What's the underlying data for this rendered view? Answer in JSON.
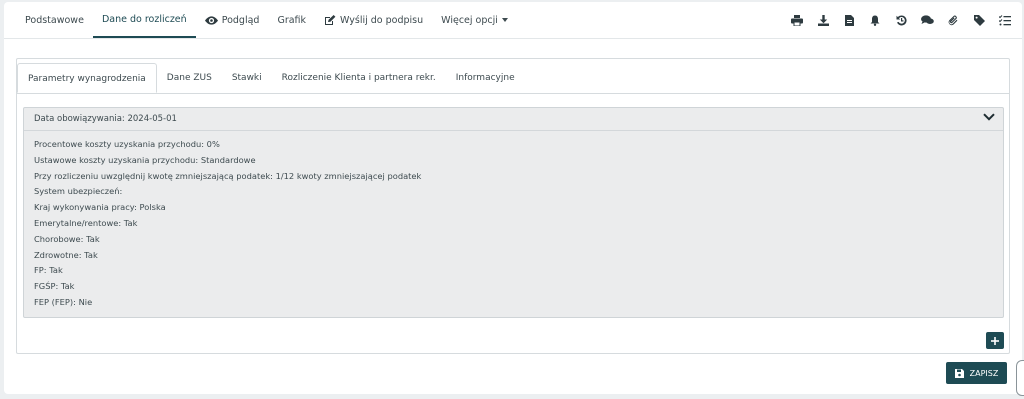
{
  "topnav": {
    "podstawowe": "Podstawowe",
    "dane": "Dane do rozliczeń",
    "podglad": "Podgląd",
    "grafik": "Grafik",
    "wyslij": "Wyślij do podpisu",
    "wiecej": "Więcej opcji"
  },
  "toolbar_icons": [
    "print-icon",
    "download-icon",
    "document-icon",
    "bell-icon",
    "history-icon",
    "comments-icon",
    "paperclip-icon",
    "tag-icon",
    "checklist-icon"
  ],
  "tabs": [
    "Parametry wynagrodzenia",
    "Dane ZUS",
    "Stawki",
    "Rozliczenie Klienta i partnera rekr.",
    "Informacyjne"
  ],
  "panel": {
    "title": "Data obowiązywania: 2024-05-01",
    "rows": [
      "Procentowe koszty uzyskania przychodu: 0%",
      "Ustawowe koszty uzyskania przychodu: Standardowe",
      "Przy rozliczeniu uwzględnij kwotę zmniejszającą podatek: 1/12 kwoty zmniejszającej podatek",
      "System ubezpieczeń:",
      "Kraj wykonywania pracy: Polska",
      "Emerytalne/rentowe: Tak",
      "Chorobowe: Tak",
      "Zdrowotne: Tak",
      "FP: Tak",
      "FGŚP: Tak",
      "FEP (FEP): Nie"
    ]
  },
  "save_label": "ZAPISZ",
  "colors": {
    "accent": "#1e4b54",
    "panel_bg": "#ebeced",
    "page_bg": "#eceff1"
  }
}
